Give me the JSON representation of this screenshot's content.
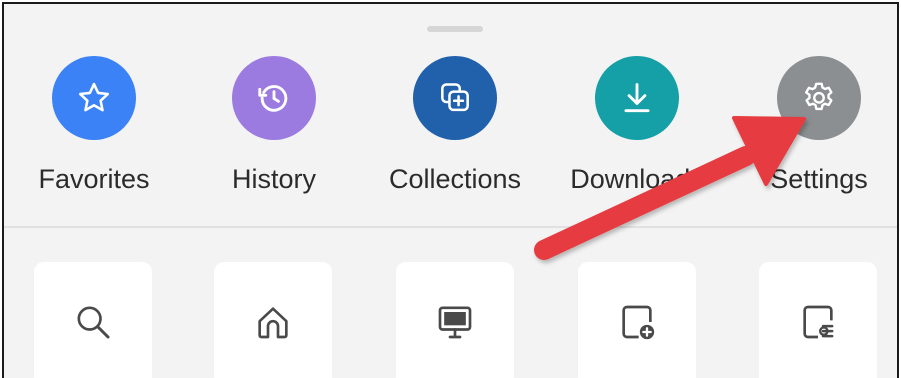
{
  "quick_actions": [
    {
      "label": "Favorites",
      "icon": "star-icon",
      "color": "#3b82f6"
    },
    {
      "label": "History",
      "icon": "history-icon",
      "color": "#9b7be0"
    },
    {
      "label": "Collections",
      "icon": "collections-icon",
      "color": "#2160ab"
    },
    {
      "label": "Downloads",
      "icon": "download-icon",
      "color": "#14a0a6"
    },
    {
      "label": "Settings",
      "icon": "gear-icon",
      "color": "#8b8f91"
    }
  ],
  "tiles": [
    {
      "icon": "search-icon"
    },
    {
      "icon": "home-icon"
    },
    {
      "icon": "desktop-site-icon"
    },
    {
      "icon": "add-page-icon"
    },
    {
      "icon": "share-page-icon"
    }
  ],
  "annotation": {
    "icon": "red-arrow-icon",
    "color": "#e63b3f",
    "points_to": "Settings"
  }
}
